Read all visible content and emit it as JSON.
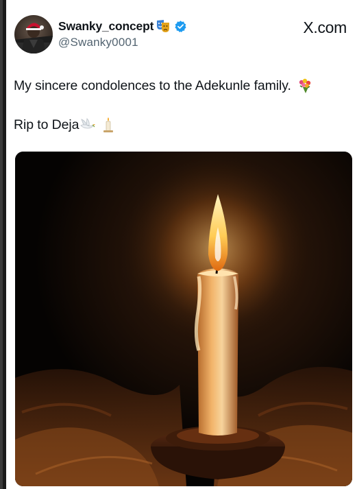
{
  "tweet": {
    "display_name": "Swanky_concept",
    "handle": "@Swanky0001",
    "source_label": "X.com",
    "text_line1": "My sincere condolences to the Adekunle family.",
    "text_line2": "Rip to Deja"
  },
  "icons": {
    "name_badge": "performing-arts-masks-icon",
    "verified": "verified-badge-icon",
    "flowers": "bouquet-icon",
    "dove": "dove-icon",
    "candle": "candle-icon",
    "brand": "x-logo-icon"
  },
  "colors": {
    "verified_blue": "#1d9bf0",
    "text": "#0f1419",
    "secondary_text": "#536471"
  }
}
